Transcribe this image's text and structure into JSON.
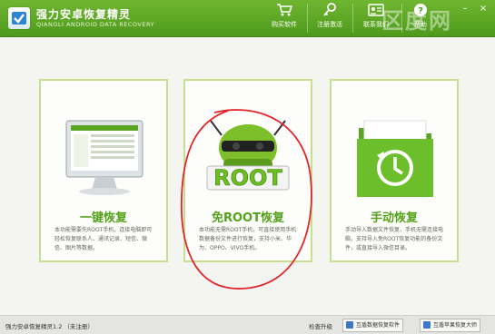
{
  "app": {
    "title": "强力安卓恢复精灵",
    "subtitle": "QIANGLI ANDROID DATA RECOVERY",
    "watermark": "区度网"
  },
  "toolbar": {
    "buy_label": "购买软件",
    "register_label": "注册激活",
    "contact_label": "联系我们",
    "help_label": "帮助"
  },
  "window_controls": {
    "minimize": "–",
    "close": "×"
  },
  "cards": [
    {
      "title": "一键恢复",
      "desc": "本功能需要先ROOT手机，连接电脑即可轻松恢复联系人、通讯记录、短信、微信、图片等数据。",
      "icon": "monitor-icon"
    },
    {
      "title": "免ROOT恢复",
      "desc": "本功能无需ROOT手机，可直接使用手机数据备份文件进行恢复，支持小米、华为、OPPO、VIVO手机。",
      "icon": "android-root-icon",
      "art_text": "ROOT"
    },
    {
      "title": "手动恢复",
      "desc": "手动导入数据文件恢复，手机无需连接电脑，支持导入免ROOT恢复功能的备份文件，或直接导入微信目录。",
      "icon": "folder-restore-icon"
    }
  ],
  "statusbar": {
    "status": "强力安卓恢复精灵1.2 （未注册）",
    "check_update": "检查升级",
    "btn1": "互盾数据恢复软件",
    "btn2": "互盾苹果恢复大师"
  },
  "colors": {
    "titlebar": "#5aa624",
    "accent": "#55a11c",
    "card_border": "#c6de8f",
    "annotation": "#e0262b"
  }
}
